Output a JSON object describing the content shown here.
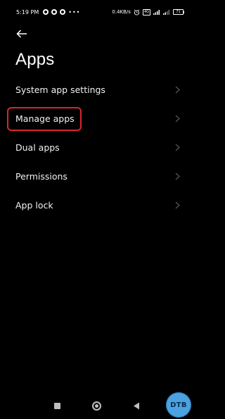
{
  "status_bar": {
    "time": "5:19 PM",
    "dots": "•••",
    "net_speed": "0.4KB/s",
    "sim_label": "4G",
    "battery_level": "71"
  },
  "header": {
    "title": "Apps"
  },
  "settings": {
    "items": [
      {
        "label": "System app settings"
      },
      {
        "label": "Manage apps"
      },
      {
        "label": "Dual apps"
      },
      {
        "label": "Permissions"
      },
      {
        "label": "App lock"
      }
    ]
  },
  "watermark": {
    "text": "DTB"
  },
  "icons": {
    "back": "back-arrow-icon",
    "chevron": "chevron-right-icon",
    "recents": "recents-icon",
    "home": "home-icon",
    "nav_back": "triangle-back-icon"
  },
  "colors": {
    "background": "#000000",
    "highlight": "#d9262c",
    "watermark": "#4aa3e0"
  }
}
